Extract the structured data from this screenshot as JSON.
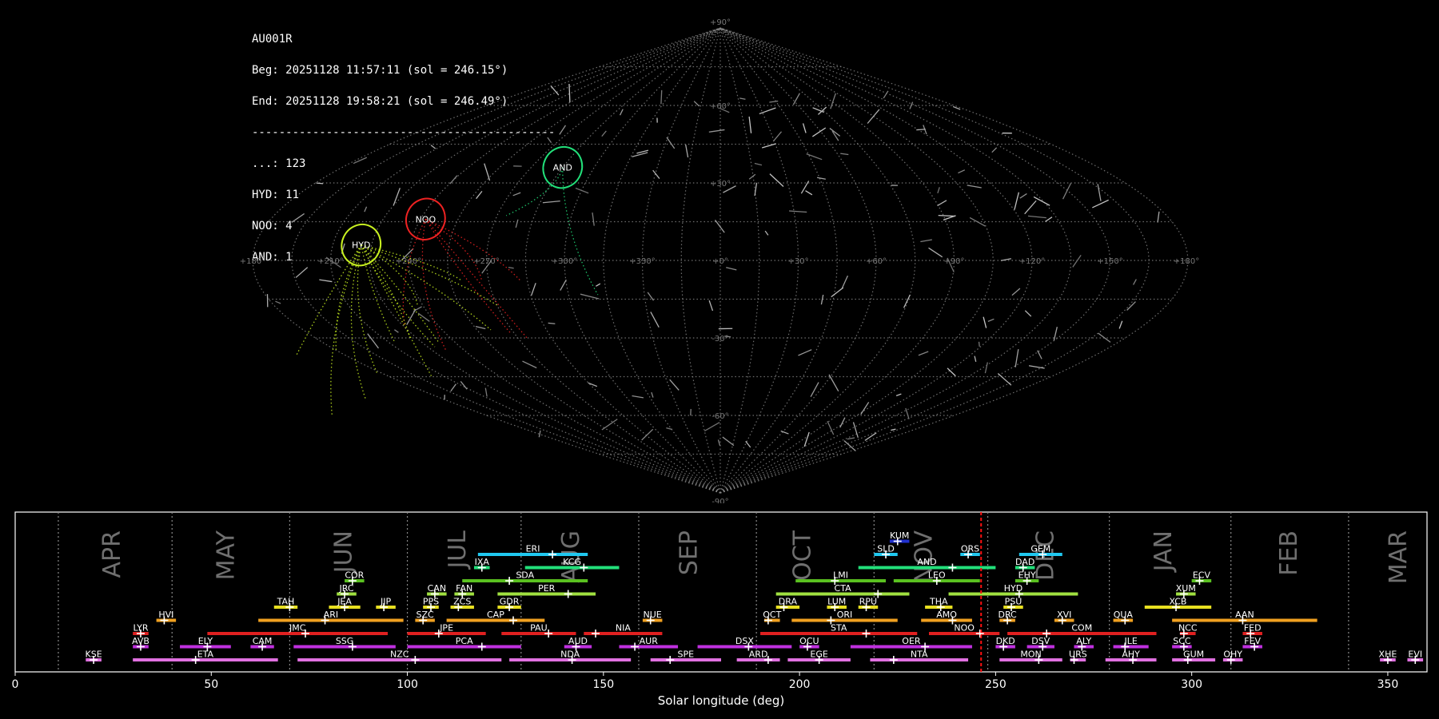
{
  "info": {
    "station": "AU001R",
    "begin": "Beg: 20251128 11:57:11 (sol = 246.15°)",
    "end": "End: 20251128 19:58:21 (sol = 246.49°)",
    "separator": "---------------------------------------------",
    "counts": [
      "...: 123",
      "HYD: 11",
      "NOO: 4",
      "AND: 1"
    ]
  },
  "sky_map": {
    "projection": "sinusoidal",
    "lon_labels": [
      "+180°",
      "+150°",
      "+120°",
      "+90°",
      "+60°",
      "+30°",
      "+0°",
      "+330°",
      "+300°",
      "+270°",
      "+240°",
      "+210°",
      "+180°"
    ],
    "lat_labels": [
      "+90°",
      "+60°",
      "+30°",
      "-30°",
      "-60°",
      "-90°"
    ],
    "radiants": [
      {
        "code": "AND",
        "lon": 75,
        "lat": 36,
        "color": "#22e07a"
      },
      {
        "code": "NOO",
        "lon": 118,
        "lat": 16,
        "color": "#ee2222"
      },
      {
        "code": "HYD",
        "lon": 139,
        "lat": 6,
        "color": "#c8f020"
      }
    ]
  },
  "chart_data": {
    "type": "gantt",
    "xlabel": "Solar longitude (deg)",
    "xlim": [
      0,
      360
    ],
    "x_ticks": [
      0,
      50,
      100,
      150,
      200,
      250,
      300,
      350
    ],
    "current_sol": 246.3,
    "month_boundaries": [
      11,
      40,
      70,
      100,
      129,
      159,
      189,
      219,
      248,
      279,
      310,
      340
    ],
    "months": [
      {
        "name": "APR",
        "x": 25
      },
      {
        "name": "MAY",
        "x": 54
      },
      {
        "name": "JUN",
        "x": 84
      },
      {
        "name": "JUL",
        "x": 113
      },
      {
        "name": "AUG",
        "x": 142
      },
      {
        "name": "SEP",
        "x": 172
      },
      {
        "name": "OCT",
        "x": 201
      },
      {
        "name": "NOV",
        "x": 232
      },
      {
        "name": "DEC",
        "x": 263
      },
      {
        "name": "JAN",
        "x": 293
      },
      {
        "name": "FEB",
        "x": 325
      },
      {
        "name": "MAR",
        "x": 353
      }
    ],
    "showers": [
      {
        "code": "KUM",
        "start": 223,
        "end": 228,
        "peak": 225,
        "row": 11,
        "color": "#2030d0"
      },
      {
        "code": "ERI",
        "start": 118,
        "end": 146,
        "peak": 137,
        "row": 10,
        "color": "#20c8f0"
      },
      {
        "code": "SLD",
        "start": 219,
        "end": 225,
        "peak": 222,
        "row": 10,
        "color": "#20c8f0"
      },
      {
        "code": "ORS",
        "start": 241,
        "end": 246,
        "peak": 243,
        "row": 10,
        "color": "#20c8f0"
      },
      {
        "code": "GEM",
        "start": 256,
        "end": 267,
        "peak": 262,
        "row": 10,
        "color": "#20c8f0"
      },
      {
        "code": "IXA",
        "start": 117,
        "end": 121,
        "peak": 119,
        "row": 9,
        "color": "#22e07a"
      },
      {
        "code": "KCG",
        "start": 130,
        "end": 154,
        "peak": 145,
        "row": 9,
        "color": "#22e07a"
      },
      {
        "code": "AND",
        "start": 215,
        "end": 250,
        "peak": 239,
        "row": 9,
        "color": "#22e07a"
      },
      {
        "code": "DAD",
        "start": 255,
        "end": 260,
        "peak": 257,
        "row": 9,
        "color": "#22e07a"
      },
      {
        "code": "COR",
        "start": 84,
        "end": 89,
        "peak": 86,
        "row": 8,
        "color": "#5ac020"
      },
      {
        "code": "SDA",
        "start": 114,
        "end": 146,
        "peak": 126,
        "row": 8,
        "color": "#5ac020"
      },
      {
        "code": "LMI",
        "start": 199,
        "end": 222,
        "peak": 209,
        "row": 8,
        "color": "#5ac020"
      },
      {
        "code": "LEO",
        "start": 224,
        "end": 246,
        "peak": 235,
        "row": 8,
        "color": "#5ac020"
      },
      {
        "code": "EHY",
        "start": 255,
        "end": 261,
        "peak": 258,
        "row": 8,
        "color": "#5ac020"
      },
      {
        "code": "ECV",
        "start": 300,
        "end": 305,
        "peak": 302,
        "row": 8,
        "color": "#5ac020"
      },
      {
        "code": "JRC",
        "start": 82,
        "end": 87,
        "peak": 84,
        "row": 7,
        "color": "#a0e040"
      },
      {
        "code": "CAN",
        "start": 105,
        "end": 110,
        "peak": 107,
        "row": 7,
        "color": "#a0e040"
      },
      {
        "code": "FAN",
        "start": 112,
        "end": 117,
        "peak": 114,
        "row": 7,
        "color": "#a0e040"
      },
      {
        "code": "PER",
        "start": 123,
        "end": 148,
        "peak": 141,
        "row": 7,
        "color": "#a0e040"
      },
      {
        "code": "CTA",
        "start": 194,
        "end": 228,
        "peak": 220,
        "row": 7,
        "color": "#a0e040"
      },
      {
        "code": "HYD",
        "start": 238,
        "end": 271,
        "peak": 256,
        "row": 7,
        "color": "#a0e040"
      },
      {
        "code": "XUM",
        "start": 296,
        "end": 301,
        "peak": 298,
        "row": 7,
        "color": "#a0e040"
      },
      {
        "code": "TAH",
        "start": 66,
        "end": 72,
        "peak": 70,
        "row": 6,
        "color": "#e8e020"
      },
      {
        "code": "JEA",
        "start": 80,
        "end": 88,
        "peak": 84,
        "row": 6,
        "color": "#e8e020"
      },
      {
        "code": "JJP",
        "start": 92,
        "end": 97,
        "peak": 94,
        "row": 6,
        "color": "#e8e020"
      },
      {
        "code": "PPS",
        "start": 104,
        "end": 108,
        "peak": 106,
        "row": 6,
        "color": "#e8e020"
      },
      {
        "code": "ZCS",
        "start": 111,
        "end": 117,
        "peak": 113,
        "row": 6,
        "color": "#e8e020"
      },
      {
        "code": "GDR",
        "start": 123,
        "end": 129,
        "peak": 126,
        "row": 6,
        "color": "#e8e020"
      },
      {
        "code": "DRA",
        "start": 194,
        "end": 200,
        "peak": 196,
        "row": 6,
        "color": "#e8e020"
      },
      {
        "code": "LUM",
        "start": 207,
        "end": 212,
        "peak": 209,
        "row": 6,
        "color": "#e8e020"
      },
      {
        "code": "RPU",
        "start": 215,
        "end": 220,
        "peak": 217,
        "row": 6,
        "color": "#e8e020"
      },
      {
        "code": "THA",
        "start": 232,
        "end": 239,
        "peak": 236,
        "row": 6,
        "color": "#e8e020"
      },
      {
        "code": "PSU",
        "start": 252,
        "end": 257,
        "peak": 254,
        "row": 6,
        "color": "#e8e020"
      },
      {
        "code": "XCB",
        "start": 288,
        "end": 305,
        "peak": 296,
        "row": 6,
        "color": "#e8e020"
      },
      {
        "code": "HVI",
        "start": 36,
        "end": 41,
        "peak": 38,
        "row": 5,
        "color": "#f0a020"
      },
      {
        "code": "ARI",
        "start": 62,
        "end": 99,
        "peak": 79,
        "row": 5,
        "color": "#f0a020"
      },
      {
        "code": "SZC",
        "start": 102,
        "end": 107,
        "peak": 104,
        "row": 5,
        "color": "#f0a020"
      },
      {
        "code": "CAP",
        "start": 110,
        "end": 135,
        "peak": 127,
        "row": 5,
        "color": "#f0a020"
      },
      {
        "code": "NUE",
        "start": 160,
        "end": 165,
        "peak": 162,
        "row": 5,
        "color": "#f0a020"
      },
      {
        "code": "OCT",
        "start": 191,
        "end": 195,
        "peak": 192,
        "row": 5,
        "color": "#f0a020"
      },
      {
        "code": "ORI",
        "start": 198,
        "end": 225,
        "peak": 208,
        "row": 5,
        "color": "#f0a020"
      },
      {
        "code": "AMO",
        "start": 231,
        "end": 244,
        "peak": 239,
        "row": 5,
        "color": "#f0a020"
      },
      {
        "code": "DRC",
        "start": 251,
        "end": 255,
        "peak": 253,
        "row": 5,
        "color": "#f0a020"
      },
      {
        "code": "XVI",
        "start": 265,
        "end": 270,
        "peak": 267,
        "row": 5,
        "color": "#f0a020"
      },
      {
        "code": "QUA",
        "start": 280,
        "end": 285,
        "peak": 283,
        "row": 5,
        "color": "#f0a020"
      },
      {
        "code": "AAN",
        "start": 295,
        "end": 332,
        "peak": 313,
        "row": 5,
        "color": "#f0a020"
      },
      {
        "code": "LYR",
        "start": 30,
        "end": 34,
        "peak": 32,
        "row": 4,
        "color": "#e02020"
      },
      {
        "code": "JMC",
        "start": 49,
        "end": 95,
        "peak": 74,
        "row": 4,
        "color": "#e02020"
      },
      {
        "code": "JPE",
        "start": 100,
        "end": 120,
        "peak": 108,
        "row": 4,
        "color": "#e02020"
      },
      {
        "code": "PAU",
        "start": 124,
        "end": 143,
        "peak": 136,
        "row": 4,
        "color": "#e02020"
      },
      {
        "code": "NIA",
        "start": 145,
        "end": 165,
        "peak": 148,
        "row": 4,
        "color": "#e02020"
      },
      {
        "code": "STA",
        "start": 190,
        "end": 230,
        "peak": 217,
        "row": 4,
        "color": "#e02020"
      },
      {
        "code": "NOO",
        "start": 233,
        "end": 251,
        "peak": 246,
        "row": 4,
        "color": "#e02020"
      },
      {
        "code": "COM",
        "start": 253,
        "end": 291,
        "peak": 263,
        "row": 4,
        "color": "#e02020"
      },
      {
        "code": "NCC",
        "start": 297,
        "end": 301,
        "peak": 298,
        "row": 4,
        "color": "#e02020"
      },
      {
        "code": "FED",
        "start": 313,
        "end": 318,
        "peak": 315,
        "row": 4,
        "color": "#e02020"
      },
      {
        "code": "AVB",
        "start": 30,
        "end": 34,
        "peak": 32,
        "row": 3,
        "color": "#c030e0"
      },
      {
        "code": "ELY",
        "start": 42,
        "end": 55,
        "peak": 49,
        "row": 3,
        "color": "#c030e0"
      },
      {
        "code": "CAM",
        "start": 60,
        "end": 66,
        "peak": 63,
        "row": 3,
        "color": "#c030e0"
      },
      {
        "code": "SSG",
        "start": 71,
        "end": 97,
        "peak": 86,
        "row": 3,
        "color": "#c030e0"
      },
      {
        "code": "PCA",
        "start": 100,
        "end": 129,
        "peak": 119,
        "row": 3,
        "color": "#c030e0"
      },
      {
        "code": "AUD",
        "start": 140,
        "end": 147,
        "peak": 143,
        "row": 3,
        "color": "#c030e0"
      },
      {
        "code": "AUR",
        "start": 154,
        "end": 169,
        "peak": 158,
        "row": 3,
        "color": "#c030e0"
      },
      {
        "code": "DSX",
        "start": 174,
        "end": 198,
        "peak": 187,
        "row": 3,
        "color": "#c030e0"
      },
      {
        "code": "OCU",
        "start": 200,
        "end": 205,
        "peak": 202,
        "row": 3,
        "color": "#c030e0"
      },
      {
        "code": "OER",
        "start": 213,
        "end": 244,
        "peak": 232,
        "row": 3,
        "color": "#c030e0"
      },
      {
        "code": "DKD",
        "start": 250,
        "end": 255,
        "peak": 252,
        "row": 3,
        "color": "#c030e0"
      },
      {
        "code": "DSV",
        "start": 258,
        "end": 265,
        "peak": 262,
        "row": 3,
        "color": "#c030e0"
      },
      {
        "code": "ALY",
        "start": 270,
        "end": 275,
        "peak": 272,
        "row": 3,
        "color": "#c030e0"
      },
      {
        "code": "JLE",
        "start": 280,
        "end": 289,
        "peak": 283,
        "row": 3,
        "color": "#c030e0"
      },
      {
        "code": "SCC",
        "start": 295,
        "end": 300,
        "peak": 298,
        "row": 3,
        "color": "#c030e0"
      },
      {
        "code": "FEV",
        "start": 313,
        "end": 318,
        "peak": 316,
        "row": 3,
        "color": "#c030e0"
      },
      {
        "code": "KSE",
        "start": 18,
        "end": 22,
        "peak": 20,
        "row": 2,
        "color": "#e070e0"
      },
      {
        "code": "ETA",
        "start": 30,
        "end": 67,
        "peak": 46,
        "row": 2,
        "color": "#e070e0"
      },
      {
        "code": "NZC",
        "start": 72,
        "end": 124,
        "peak": 102,
        "row": 2,
        "color": "#e070e0"
      },
      {
        "code": "NDA",
        "start": 126,
        "end": 157,
        "peak": 142,
        "row": 2,
        "color": "#e070e0"
      },
      {
        "code": "SPE",
        "start": 162,
        "end": 180,
        "peak": 167,
        "row": 2,
        "color": "#e070e0"
      },
      {
        "code": "ARD",
        "start": 184,
        "end": 195,
        "peak": 192,
        "row": 2,
        "color": "#e070e0"
      },
      {
        "code": "EGE",
        "start": 197,
        "end": 213,
        "peak": 205,
        "row": 2,
        "color": "#e070e0"
      },
      {
        "code": "NTA",
        "start": 218,
        "end": 243,
        "peak": 224,
        "row": 2,
        "color": "#e070e0"
      },
      {
        "code": "MON",
        "start": 251,
        "end": 267,
        "peak": 261,
        "row": 2,
        "color": "#e070e0"
      },
      {
        "code": "URS",
        "start": 269,
        "end": 273,
        "peak": 270,
        "row": 2,
        "color": "#e070e0"
      },
      {
        "code": "AHY",
        "start": 278,
        "end": 291,
        "peak": 285,
        "row": 2,
        "color": "#e070e0"
      },
      {
        "code": "GUM",
        "start": 295,
        "end": 306,
        "peak": 299,
        "row": 2,
        "color": "#e070e0"
      },
      {
        "code": "OHY",
        "start": 308,
        "end": 313,
        "peak": 310,
        "row": 2,
        "color": "#e070e0"
      },
      {
        "code": "XHE",
        "start": 348,
        "end": 352,
        "peak": 350,
        "row": 2,
        "color": "#e070e0"
      },
      {
        "code": "EVI",
        "start": 355,
        "end": 359,
        "peak": 357,
        "row": 2,
        "color": "#e070e0"
      }
    ]
  }
}
